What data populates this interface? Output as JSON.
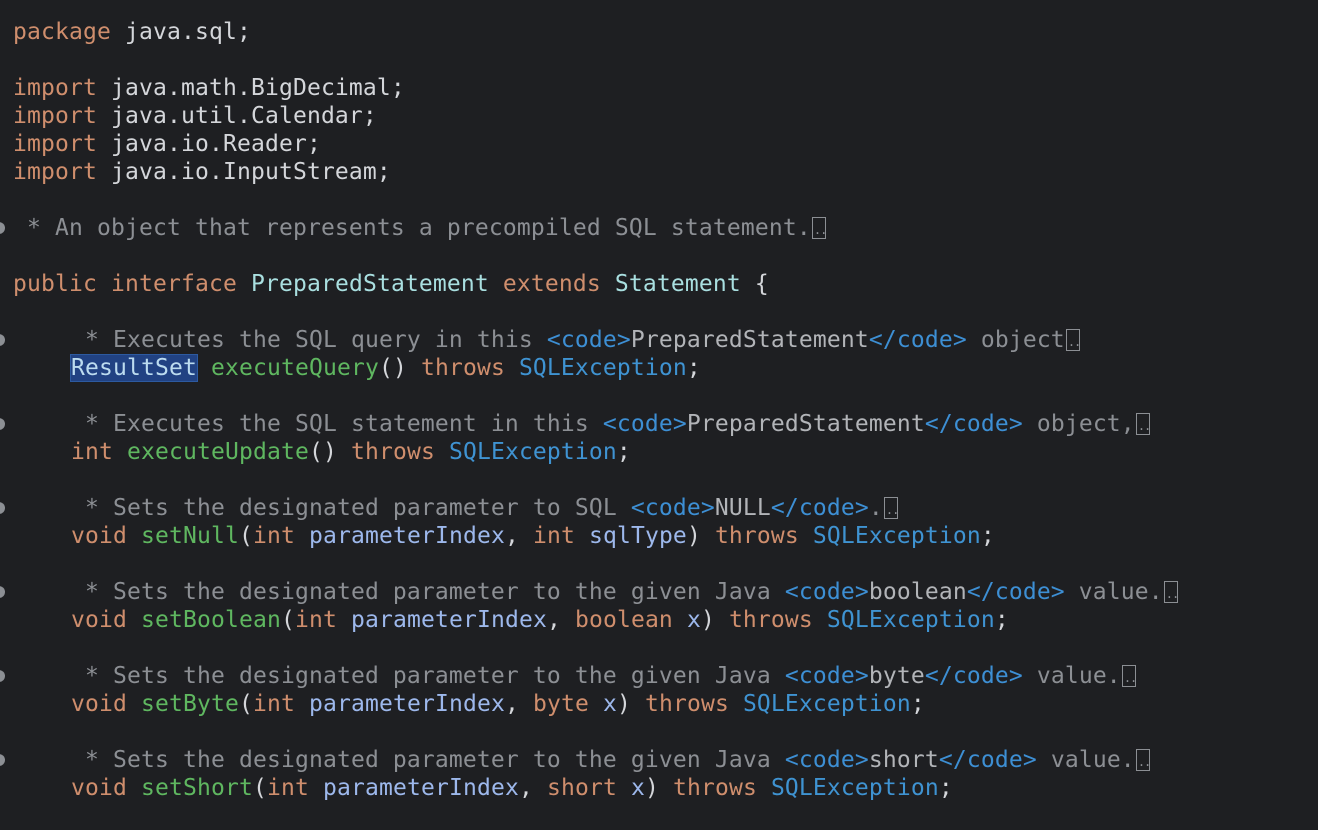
{
  "editor": {
    "lines": {
      "package": {
        "kw": "package",
        "rest": " java.sql;"
      },
      "imports": [
        {
          "kw": "import",
          "rest": " java.math.BigDecimal;"
        },
        {
          "kw": "import",
          "rest": " java.util.Calendar;"
        },
        {
          "kw": "import",
          "rest": " java.io.Reader;"
        },
        {
          "kw": "import",
          "rest": " java.io.InputStream;"
        }
      ],
      "class_doc": " * An object that represents a precompiled SQL statement.",
      "interface_decl": {
        "public": "public",
        "interface": "interface",
        "name": "PreparedStatement",
        "extends": "extends",
        "parent": "Statement",
        "brace": " {"
      },
      "methods": [
        {
          "doc_prefix": " * Executes the SQL query in this ",
          "doc_open": "<code>",
          "doc_code": "PreparedStatement",
          "doc_close": "</code>",
          "doc_suffix": " object",
          "return_type": "ResultSet",
          "name": "executeQuery",
          "params": "()",
          "throws": "throws",
          "exception": "SQLException",
          "end": ";"
        },
        {
          "doc_prefix": " * Executes the SQL statement in this ",
          "doc_open": "<code>",
          "doc_code": "PreparedStatement",
          "doc_close": "</code>",
          "doc_suffix": " object,",
          "return_type": "int",
          "name": "executeUpdate",
          "params": "()",
          "throws": "throws",
          "exception": "SQLException",
          "end": ";"
        },
        {
          "doc_prefix": " * Sets the designated parameter to SQL ",
          "doc_open": "<code>",
          "doc_code": "NULL",
          "doc_close": "</code>",
          "doc_suffix": ".",
          "return_type": "void",
          "name": "setNull",
          "p1_type": "int",
          "p1_name": "parameterIndex",
          "p2_type": "int",
          "p2_name": "sqlType",
          "throws": "throws",
          "exception": "SQLException",
          "end": ";"
        },
        {
          "doc_prefix": " * Sets the designated parameter to the given Java ",
          "doc_open": "<code>",
          "doc_code": "boolean",
          "doc_close": "</code>",
          "doc_suffix": " value.",
          "return_type": "void",
          "name": "setBoolean",
          "p1_type": "int",
          "p1_name": "parameterIndex",
          "p2_type": "boolean",
          "p2_name": "x",
          "throws": "throws",
          "exception": "SQLException",
          "end": ";"
        },
        {
          "doc_prefix": " * Sets the designated parameter to the given Java ",
          "doc_open": "<code>",
          "doc_code": "byte",
          "doc_close": "</code>",
          "doc_suffix": " value.",
          "return_type": "void",
          "name": "setByte",
          "p1_type": "int",
          "p1_name": "parameterIndex",
          "p2_type": "byte",
          "p2_name": "x",
          "throws": "throws",
          "exception": "SQLException",
          "end": ";"
        },
        {
          "doc_prefix": " * Sets the designated parameter to the given Java ",
          "doc_open": "<code>",
          "doc_code": "short",
          "doc_close": "</code>",
          "doc_suffix": " value.",
          "return_type": "void",
          "name": "setShort",
          "p1_type": "int",
          "p1_name": "parameterIndex",
          "p2_type": "short",
          "p2_name": "x",
          "throws": "throws",
          "exception": "SQLException",
          "end": ";"
        }
      ]
    },
    "colors": {
      "background": "#1e1f22",
      "keyword": "#cf8e6d",
      "type_name": "#a9dfe0",
      "method_declaration": "#5fb760",
      "parameter": "#9db8ec",
      "doc_comment": "#8c8f94",
      "doc_tag": "#3d8fd4",
      "selection": "#214283"
    }
  }
}
